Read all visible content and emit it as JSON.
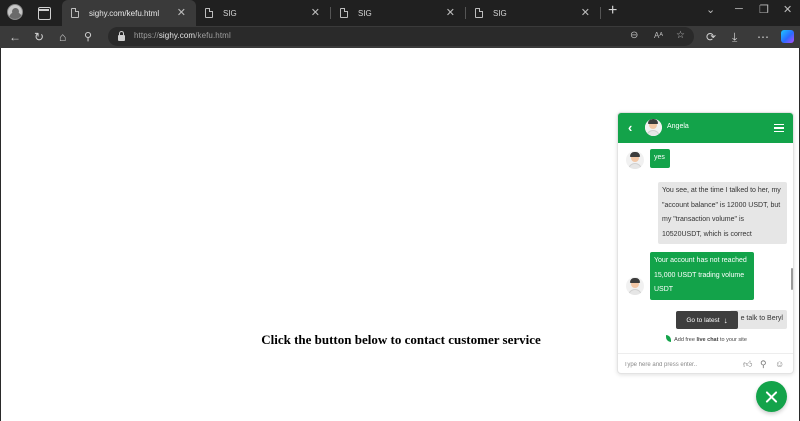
{
  "browser": {
    "tabs": [
      {
        "title": "sighy.com/kefu.html",
        "active": true
      },
      {
        "title": "SIG",
        "active": false
      },
      {
        "title": "SIG",
        "active": false
      },
      {
        "title": "SIG",
        "active": false
      }
    ],
    "url_prefix": "https://",
    "url_domain": "sighy.com",
    "url_path": "/kefu.html"
  },
  "page": {
    "cta_text": "Click the button below to contact customer service"
  },
  "chat": {
    "agent_name": "Angela",
    "messages": [
      {
        "from": "agent",
        "text": "yes"
      },
      {
        "from": "user",
        "text": "You see, at the time I talked to her, my \"account balance\" is 12000 USDT, but my \"transaction volume\" is 10520USDT, which is correct"
      },
      {
        "from": "agent",
        "text": "Your account has not reached 15,000 USDT trading volume USDT"
      },
      {
        "from": "user",
        "text": "e talk to Beryl"
      }
    ],
    "go_to_latest_label": "Go to latest",
    "powered_prefix": "Add free ",
    "powered_bold": "live chat",
    "powered_suffix": " to your site",
    "input_placeholder": "Type here and press enter..",
    "accent_color": "#13a34a"
  },
  "icons": {
    "back": "arrow-left-icon",
    "menu": "hamburger-icon",
    "close": "close-icon"
  }
}
